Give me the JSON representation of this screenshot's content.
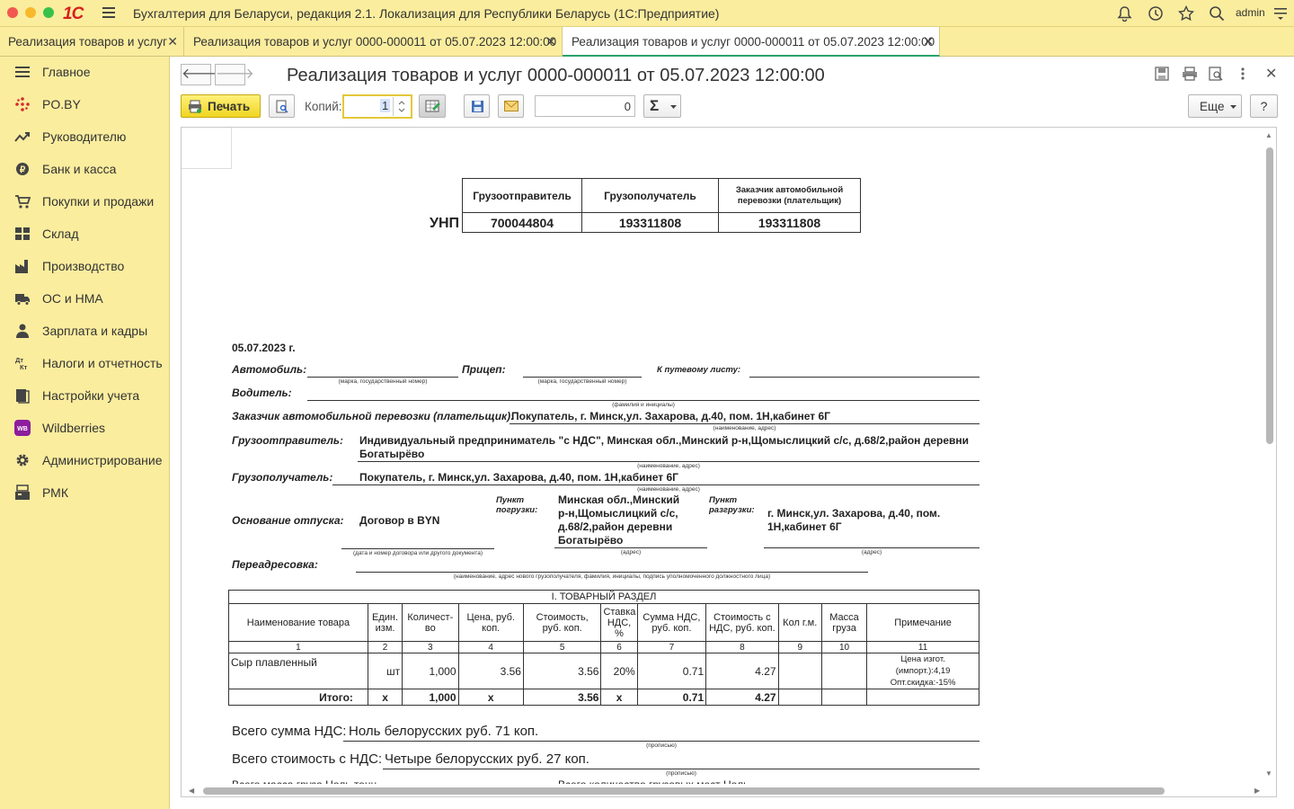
{
  "titlebar": {
    "title": "Бухгалтерия для Беларуси, редакция 2.1. Локализация для Республики Беларусь   (1С:Предприятие)",
    "user": "admin",
    "logo": "1С"
  },
  "tabs": [
    {
      "label": "Реализация товаров и услуг"
    },
    {
      "label": "Реализация товаров и услуг 0000-000011 от 05.07.2023 12:00:00"
    },
    {
      "label": "Реализация товаров и услуг 0000-000011 от 05.07.2023 12:00:00"
    }
  ],
  "sidebar": {
    "items": [
      {
        "label": "Главное",
        "icon": "menu-icon"
      },
      {
        "label": "PO.BY",
        "icon": "dots-icon"
      },
      {
        "label": "Руководителю",
        "icon": "trend-icon"
      },
      {
        "label": "Банк и касса",
        "icon": "coin-icon"
      },
      {
        "label": "Покупки и продажи",
        "icon": "cart-icon"
      },
      {
        "label": "Склад",
        "icon": "grid-icon"
      },
      {
        "label": "Производство",
        "icon": "factory-icon"
      },
      {
        "label": "ОС и НМА",
        "icon": "truck-icon"
      },
      {
        "label": "Зарплата и кадры",
        "icon": "person-icon"
      },
      {
        "label": "Налоги и отчетность",
        "icon": "dtkt-icon",
        "icon_text": "Дт Кт"
      },
      {
        "label": "Настройки учета",
        "icon": "books-icon"
      },
      {
        "label": "Wildberries",
        "icon": "wb-icon",
        "icon_text": "WB"
      },
      {
        "label": "Администрирование",
        "icon": "gear-icon"
      },
      {
        "label": "РМК",
        "icon": "register-icon"
      }
    ]
  },
  "form": {
    "title": "Реализация товаров и услуг 0000-000011 от 05.07.2023 12:00:00",
    "print_label": "Печать",
    "copies_label": "Копий:",
    "copies_value": "1",
    "sum_value": "0",
    "sum_symbol": "Σ",
    "more_label": "Еще",
    "help_label": "?"
  },
  "document": {
    "unp_label": "УНП",
    "unp_headers": [
      "Грузоотправитель",
      "Грузополучатель",
      "Заказчик    автомобильной перевозки (плательщик)"
    ],
    "unp_values": [
      "700044804",
      "193311808",
      "193311808"
    ],
    "date": "05.07.2023 г.",
    "auto_label": "Автомобиль:",
    "trailer_label": "Прицеп:",
    "waybill_label": "К путевому листу:",
    "hint_brand": "(марка, государственный номер)",
    "driver_label": "Водитель:",
    "hint_fio": "(фамилия и инициалы)",
    "customer_label": "Заказчик автомобильной перевозки (плательщик):",
    "customer_value": "Покупатель, г. Минск,ул. Захарова, д.40, пом. 1Н,кабинет 6Г",
    "hint_name_addr": "(наименование, адрес)",
    "shipper_label": "Грузоотправитель:",
    "shipper_value_1": "Индивидуальный предприниматель \"с НДС\", Минская обл.,Минский р-н,Щомыслицкий с/с, д.68/2,район деревни",
    "shipper_value_2": "Богатырёво",
    "consignee_label": "Грузополучатель:",
    "consignee_value": "Покупатель, г. Минск,ул. Захарова, д.40, пом. 1Н,кабинет 6Г",
    "basis_label": "Основание отпуска:",
    "basis_value": "Договор в BYN",
    "hint_contract": "(дата и номер договора или другого документа)",
    "loading_label_1": "Пункт",
    "loading_label_2": "погрузки:",
    "loading_value_1": "Минская обл.,Минский",
    "loading_value_2": "р-н,Щомыслицкий с/с,",
    "loading_value_3": "д.68/2,район деревни",
    "loading_value_4": "Богатырёво",
    "hint_addr": "(адрес)",
    "unloading_label_1": "Пункт",
    "unloading_label_2": "разгрузки:",
    "unloading_value_1": "г. Минск,ул. Захарова, д.40, пом.",
    "unloading_value_2": "1Н,кабинет 6Г",
    "readdress_label": "Переадресовка:",
    "hint_readdress": "(наименование, адрес нового грузополучателя, фамилия, инициалы, подпись уполномоченного должностного лица)",
    "section_title": "I. ТОВАРНЫЙ РАЗДЕЛ",
    "columns": [
      "Наименование товара",
      "Един. изм.",
      "Количест-во",
      "Цена, руб. коп.",
      "Стоимость, руб. коп.",
      "Ставка НДС, %",
      "Сумма НДС, руб. коп.",
      "Стоимость с НДС, руб. коп.",
      "Кол г.м.",
      "Масса груза",
      "Примечание"
    ],
    "column_numbers": [
      "1",
      "2",
      "3",
      "4",
      "5",
      "6",
      "7",
      "8",
      "9",
      "10",
      "11"
    ],
    "rows": [
      {
        "name": "Сыр плавленный",
        "unit": "шт",
        "qty": "1,000",
        "price": "3.56",
        "cost": "3.56",
        "vat_rate": "20%",
        "vat_sum": "0.71",
        "total": "4.27",
        "places": "",
        "mass": "",
        "note_1": "Цена изгот.",
        "note_2": "(импорт.):4,19",
        "note_3": "Опт.скидка:-15%"
      }
    ],
    "totals": {
      "label": "Итого:",
      "unit": "х",
      "qty": "1,000",
      "price": "х",
      "cost": "3.56",
      "vat_rate": "х",
      "vat_sum": "0.71",
      "total": "4.27"
    },
    "vat_total_label": "Всего сумма НДС:",
    "vat_total_value": "Ноль белорусских руб. 71 коп.",
    "hint_words": "(прописью)",
    "total_label": "Всего стоимость с НДС:",
    "total_value": "Четыре белорусских руб. 27 коп.",
    "mass_cut": "Всего масса груза  Ноль тонн",
    "places_cut": "Всего количество грузовых мест Ноль"
  }
}
